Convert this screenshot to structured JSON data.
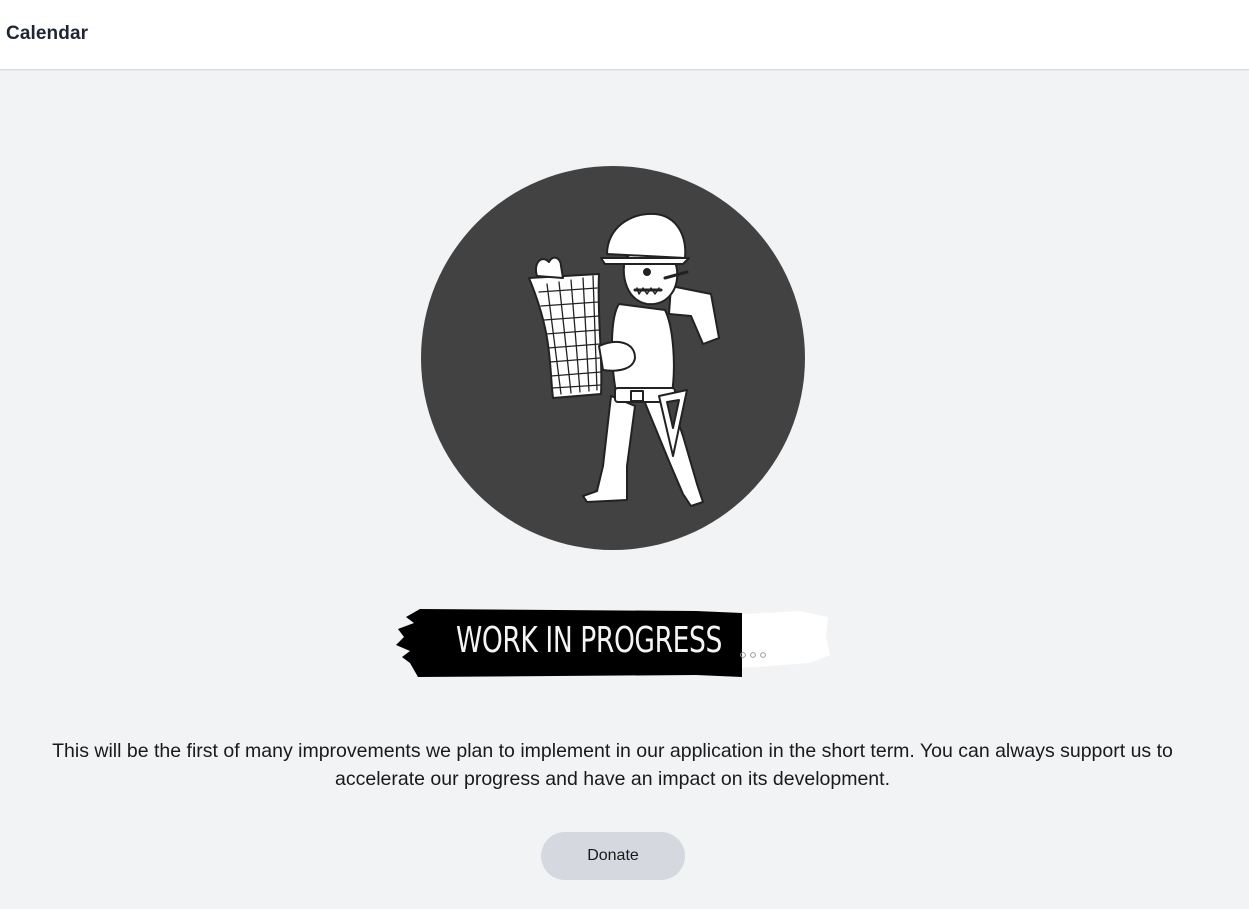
{
  "header": {
    "title": "Calendar"
  },
  "hero": {
    "icon": "construction-worker-illustration",
    "banner_text": "WORK IN PROGRESS",
    "banner_icon": "ellipsis-dots"
  },
  "message": {
    "text": "This will be the first of many improvements we plan to implement in our application in the short term. You can always support us to accelerate our progress and have an impact on its development."
  },
  "actions": {
    "donate_label": "Donate"
  },
  "colors": {
    "page_background": "#f2f3f5",
    "header_background": "#ffffff",
    "circle": "#424242",
    "button_background": "#d5d8df"
  }
}
